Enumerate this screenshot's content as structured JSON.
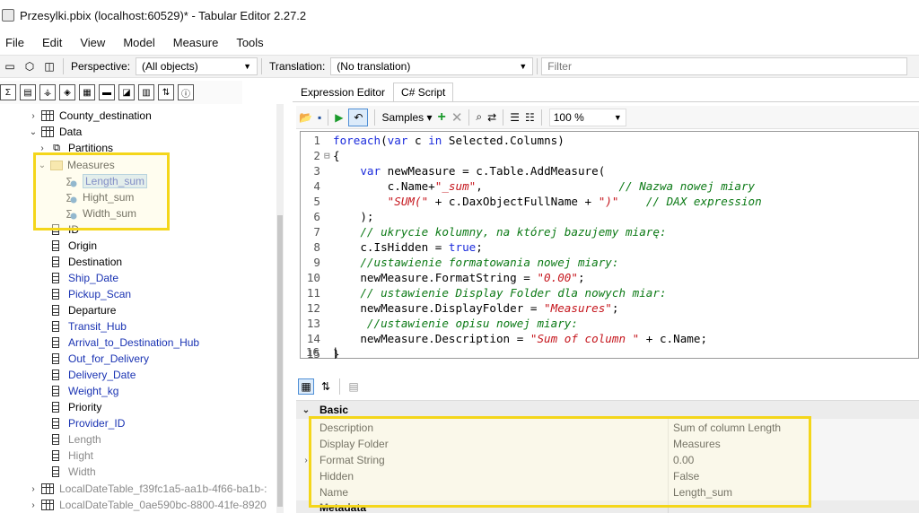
{
  "window": {
    "title": "Przesylki.pbix (localhost:60529)* - Tabular Editor 2.27.2"
  },
  "menu": [
    "File",
    "Edit",
    "View",
    "Model",
    "Measure",
    "Tools"
  ],
  "toolbar1": {
    "perspective_label": "Perspective:",
    "perspective_value": "(All objects)",
    "translation_label": "Translation:",
    "translation_value": "(No translation)",
    "filter_placeholder": "Filter"
  },
  "tree": {
    "items": [
      {
        "label": "County_destination",
        "kind": "table",
        "expanded": false
      },
      {
        "label": "Data",
        "kind": "table",
        "expanded": true
      },
      {
        "label": "Partitions",
        "kind": "partitions",
        "expanded": false
      },
      {
        "label": "Measures",
        "kind": "folder",
        "expanded": true
      },
      {
        "label": "Length_sum",
        "kind": "measure",
        "selected": true
      },
      {
        "label": "Hight_sum",
        "kind": "measure"
      },
      {
        "label": "Width_sum",
        "kind": "measure"
      },
      {
        "label": "ID",
        "kind": "column"
      },
      {
        "label": "Origin",
        "kind": "column"
      },
      {
        "label": "Destination",
        "kind": "column"
      },
      {
        "label": "Ship_Date",
        "kind": "column",
        "color": "blue"
      },
      {
        "label": "Pickup_Scan",
        "kind": "column",
        "color": "blue"
      },
      {
        "label": "Departure",
        "kind": "column"
      },
      {
        "label": "Transit_Hub",
        "kind": "column",
        "color": "blue"
      },
      {
        "label": "Arrival_to_Destination_Hub",
        "kind": "column",
        "color": "blue"
      },
      {
        "label": "Out_for_Delivery",
        "kind": "column",
        "color": "blue"
      },
      {
        "label": "Delivery_Date",
        "kind": "column",
        "color": "blue"
      },
      {
        "label": "Weight_kg",
        "kind": "column",
        "color": "blue"
      },
      {
        "label": "Priority",
        "kind": "column"
      },
      {
        "label": "Provider_ID",
        "kind": "column",
        "color": "blue"
      },
      {
        "label": "Length",
        "kind": "column",
        "color": "gray"
      },
      {
        "label": "Hight",
        "kind": "column",
        "color": "gray"
      },
      {
        "label": "Width",
        "kind": "column",
        "color": "gray"
      },
      {
        "label": "LocalDateTable_f39fc1a5-aa1b-4f66-ba1b-:",
        "kind": "table",
        "color": "gray"
      },
      {
        "label": "LocalDateTable_0ae590bc-8800-41fe-8920",
        "kind": "table",
        "color": "gray"
      }
    ]
  },
  "tabs": [
    "Expression Editor",
    "C# Script"
  ],
  "script_toolbar": {
    "samples_label": "Samples",
    "zoom": "100 %"
  },
  "code": {
    "lines": [
      "foreach(var c in Selected.Columns)",
      "{",
      "    var newMeasure = c.Table.AddMeasure(",
      "        c.Name+\"_sum\",                    // Nazwa nowej miary",
      "        \"SUM(\" + c.DaxObjectFullName + \")\"    // DAX expression",
      "    );",
      "    // ukrycie kolumny, na której bazujemy miarę:",
      "    c.IsHidden = true;",
      "    //ustawienie formatowania nowej miary:",
      "    newMeasure.FormatString = \"0.00\";",
      "    // ustawienie Display Folder dla nowych miar:",
      "    newMeasure.DisplayFolder = \"Measures\";",
      "     //ustawienie opisu nowej miary:",
      "    newMeasure.Description = \"Sum of column \" + c.Name;",
      "}",
      ""
    ]
  },
  "properties": {
    "category": "Basic",
    "rows": [
      {
        "name": "Description",
        "value": "Sum of column Length"
      },
      {
        "name": "Display Folder",
        "value": "Measures"
      },
      {
        "name": "Format String",
        "value": "0.00",
        "expandable": true
      },
      {
        "name": "Hidden",
        "value": "False"
      },
      {
        "name": "Name",
        "value": "Length_sum"
      }
    ],
    "next_category": "Metadata"
  },
  "colors": {
    "highlight": "#f4d61a",
    "blue_text": "#1a33b3",
    "keyword": "#1b2bdc",
    "string": "#c5161d",
    "comment": "#0c7a16"
  }
}
